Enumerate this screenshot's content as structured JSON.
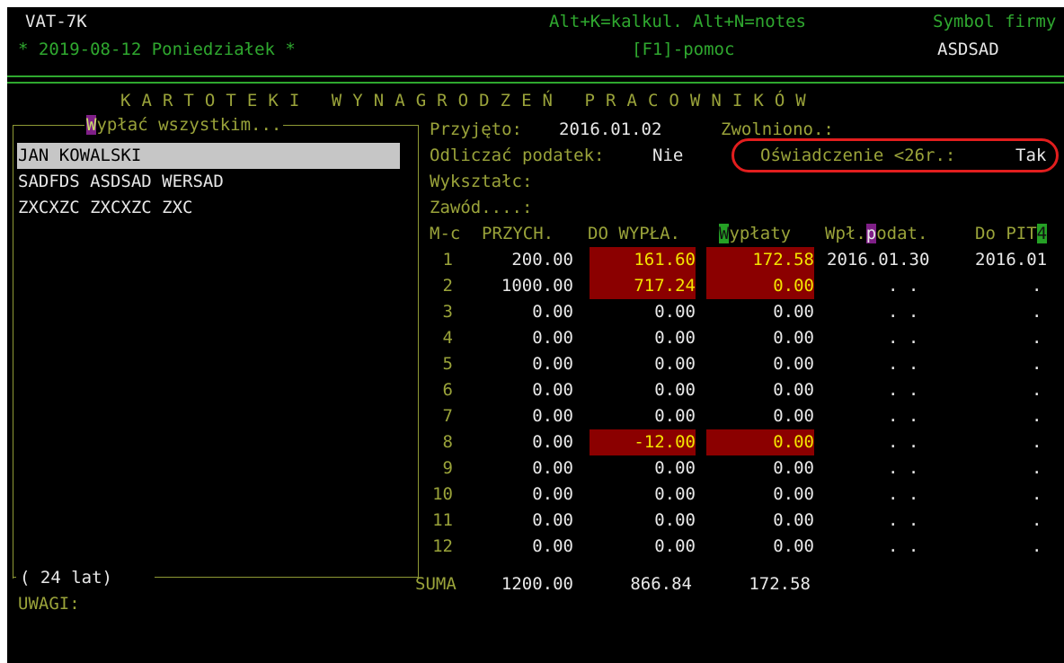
{
  "header": {
    "app_name": "VAT-7K",
    "date_line": "* 2019-08-12 Poniedziałek *",
    "shortcuts": "Alt+K=kalkul. Alt+N=notes",
    "symbol_label": "Symbol firmy",
    "help": "[F1]-pomoc",
    "company_symbol": "ASDSAD"
  },
  "title": "K A R T O T E K I   W Y N A G R O D Z E Ń   P R A C O W N I K Ó W",
  "left_panel": {
    "title_hotkey": "W",
    "title_rest": "ypłać wszystkim...",
    "employees": [
      "JAN KOWALSKI",
      "SADFDS ASDSAD WERSAD",
      "ZXCXZC ZXCXZC ZXC"
    ],
    "age_label": "( 24 lat)"
  },
  "details": {
    "hired_label": "Przyjęto:",
    "hired_value": "2016.01.02",
    "fired_label": "Zwolniono.:",
    "deduct_tax_label": "Odliczać podatek:",
    "deduct_tax_value": "Nie",
    "declaration_label": "Oświadczenie <26r.:",
    "declaration_value": "Tak",
    "education_label": "Wykształc:",
    "profession_label": "Zawód....:"
  },
  "table": {
    "col_month": "M-c",
    "col_income": "PRZYCH.",
    "col_to_pay": "DO WYPŁA.",
    "col_payments_hotkey": "W",
    "col_payments_rest": "ypłaty",
    "col_tax_pay_pre": "Wpł.",
    "col_tax_pay_hotkey": "p",
    "col_tax_pay_rest": "odat.",
    "col_pit_pre": "Do PIT",
    "col_pit_hotkey": "4",
    "rows": [
      {
        "m": "1",
        "income": "200.00",
        "to_pay": "161.60",
        "paid": "172.58",
        "tax_date": "2016.01.30",
        "pit": "2016.01"
      },
      {
        "m": "2",
        "income": "1000.00",
        "to_pay": "717.24",
        "paid": "0.00",
        "tax_date": ". .",
        "pit": "."
      },
      {
        "m": "3",
        "income": "0.00",
        "to_pay": "0.00",
        "paid": "0.00",
        "tax_date": ". .",
        "pit": "."
      },
      {
        "m": "4",
        "income": "0.00",
        "to_pay": "0.00",
        "paid": "0.00",
        "tax_date": ". .",
        "pit": "."
      },
      {
        "m": "5",
        "income": "0.00",
        "to_pay": "0.00",
        "paid": "0.00",
        "tax_date": ". .",
        "pit": "."
      },
      {
        "m": "6",
        "income": "0.00",
        "to_pay": "0.00",
        "paid": "0.00",
        "tax_date": ". .",
        "pit": "."
      },
      {
        "m": "7",
        "income": "0.00",
        "to_pay": "0.00",
        "paid": "0.00",
        "tax_date": ". .",
        "pit": "."
      },
      {
        "m": "8",
        "income": "0.00",
        "to_pay": "-12.00",
        "paid": "0.00",
        "tax_date": ". .",
        "pit": "."
      },
      {
        "m": "9",
        "income": "0.00",
        "to_pay": "0.00",
        "paid": "0.00",
        "tax_date": ". .",
        "pit": "."
      },
      {
        "m": "10",
        "income": "0.00",
        "to_pay": "0.00",
        "paid": "0.00",
        "tax_date": ". .",
        "pit": "."
      },
      {
        "m": "11",
        "income": "0.00",
        "to_pay": "0.00",
        "paid": "0.00",
        "tax_date": ". .",
        "pit": "."
      },
      {
        "m": "12",
        "income": "0.00",
        "to_pay": "0.00",
        "paid": "0.00",
        "tax_date": ". .",
        "pit": "."
      }
    ],
    "sum_label": "SUMA",
    "sum_income": "1200.00",
    "sum_to_pay": "866.84",
    "sum_paid": "172.58"
  },
  "notes_label": "UWAGI:",
  "colors": {
    "background": "#000000",
    "label_green": "#2fa82f",
    "highlight_red": "#8b0000",
    "annotation_red": "#e21e1e",
    "selection_gray": "#c6c6c6"
  }
}
